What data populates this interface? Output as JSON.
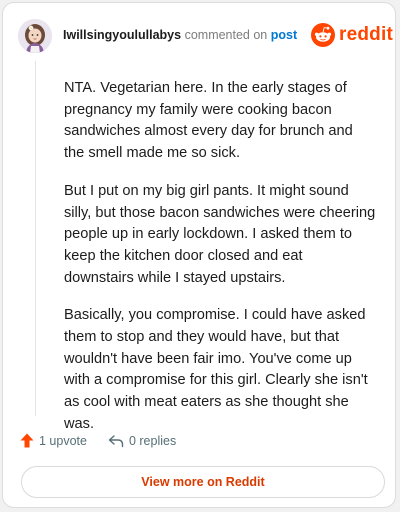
{
  "header": {
    "username": "Iwillsingyoulullabys",
    "commented_on": "commented on",
    "post_link": "post"
  },
  "brand": {
    "logo_text": "reddit",
    "logo_color": "#ff4500"
  },
  "comment": {
    "paragraphs": [
      "NTA. Vegetarian here. In the early stages of pregnancy my family were cooking bacon sandwiches almost every day for brunch and the smell made me so sick.",
      "But I put on my big girl pants. It might sound silly, but those bacon sandwiches were cheering people up in early lockdown. I asked them to keep the kitchen door closed and eat downstairs while I stayed upstairs.",
      "Basically, you compromise. I could have asked them to stop and they would have, but that wouldn't have been fair imo. You've come up with a compromise for this girl. Clearly she isn't as cool with meat eaters as she thought she was."
    ]
  },
  "actions": {
    "upvote_label": "1 upvote",
    "replies_label": "0 replies",
    "upvote_icon": "upvote-arrow-icon",
    "reply_icon": "reply-icon",
    "upvote_color": "#ff4500"
  },
  "footer": {
    "view_more_label": "View more on Reddit",
    "view_more_color": "#d93a00"
  }
}
